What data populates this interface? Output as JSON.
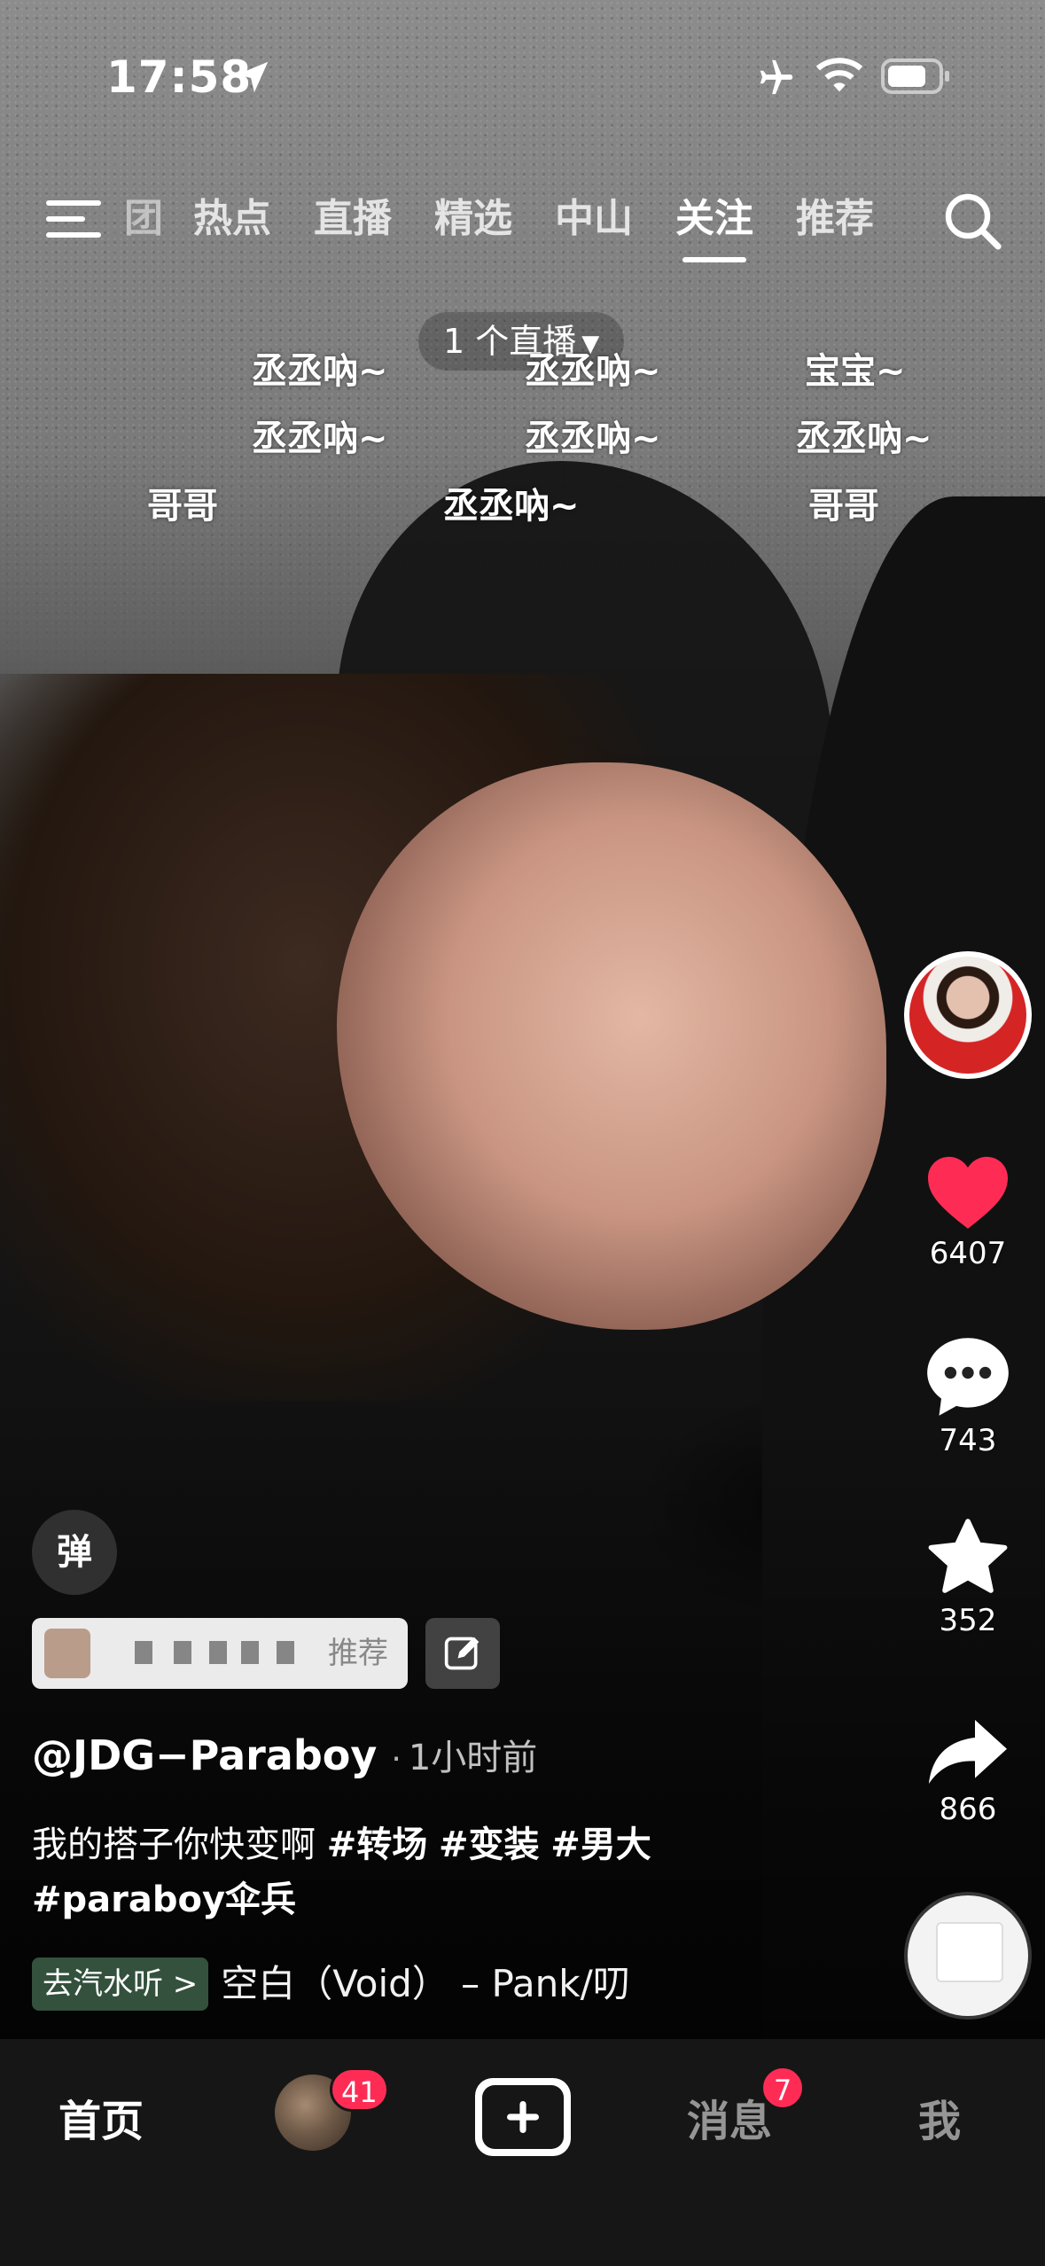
{
  "status_bar": {
    "time": "17:58"
  },
  "top_nav": {
    "tabs": [
      "团",
      "热点",
      "直播",
      "精选",
      "中山",
      "关注",
      "推荐"
    ],
    "active_tab": "关注"
  },
  "live_indicator": {
    "label": "1 个直播"
  },
  "danmaku": [
    "丞丞吶~",
    "丞丞吶~",
    "宝宝~",
    "丞丞吶~",
    "丞丞吶~",
    "丞丞吶~",
    "哥哥",
    "丞丞吶~",
    "哥哥"
  ],
  "actions": {
    "likes": "6407",
    "comments": "743",
    "favorites": "352",
    "shares": "866"
  },
  "video_info": {
    "danmu_toggle_label": "弹",
    "recommend_text": "推荐",
    "author": "@JDG−Paraboy",
    "separator": "·",
    "time_ago": "1小时前",
    "caption_text": "我的搭子你快变啊 ",
    "hashtags": [
      "#转场",
      "#变装",
      "#男大",
      "#paraboy伞兵"
    ],
    "music_tag": "去汽水听 >",
    "music_title": "空白（Void） – Pank/叨"
  },
  "bottom_tabs": {
    "home": "首页",
    "friends_badge": "41",
    "messages": "消息",
    "messages_badge": "7",
    "me": "我"
  },
  "colors": {
    "like_red": "#fe2c55",
    "badge_red": "#fe2c55",
    "tab_bar_bg": "#161616"
  },
  "icons": [
    "location-arrow-icon",
    "airplane-icon",
    "wifi-icon",
    "battery-icon",
    "menu-icon",
    "search-icon",
    "heart-icon",
    "comment-icon",
    "star-icon",
    "share-icon",
    "edit-icon",
    "plus-icon"
  ]
}
